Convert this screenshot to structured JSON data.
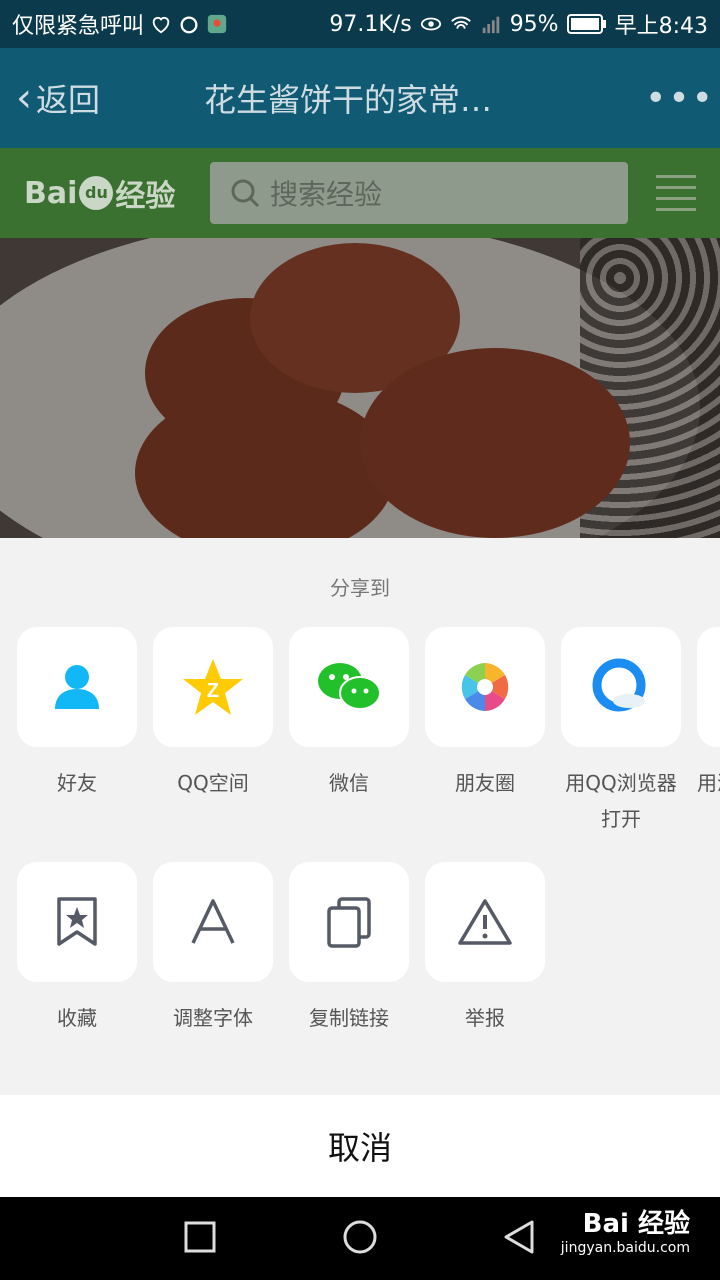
{
  "status_bar": {
    "carrier": "仅限紧急呼叫",
    "speed": "97.1K/s",
    "battery": "95%",
    "time": "早上8:43"
  },
  "app_bar": {
    "back_label": "返回",
    "title": "花生酱饼干的家常…",
    "more_icon": "more-dots-icon"
  },
  "baidu_header": {
    "logo_text_left": "Bai",
    "logo_text_paw": "du",
    "logo_text_right": "经验",
    "search_placeholder": "搜索经验"
  },
  "share_sheet": {
    "title": "分享到",
    "row1": [
      {
        "label": "好友",
        "icon": "qq-friend-icon"
      },
      {
        "label": "QQ空间",
        "icon": "qzone-star-icon"
      },
      {
        "label": "微信",
        "icon": "wechat-icon"
      },
      {
        "label": "朋友圈",
        "icon": "moments-aperture-icon"
      },
      {
        "label": "用QQ浏览器\n打开",
        "icon": "qq-browser-icon"
      },
      {
        "label": "用浏",
        "icon": "browser-icon"
      }
    ],
    "row2": [
      {
        "label": "收藏",
        "icon": "bookmark-star-icon"
      },
      {
        "label": "调整字体",
        "icon": "font-a-icon"
      },
      {
        "label": "复制链接",
        "icon": "copy-icon"
      },
      {
        "label": "举报",
        "icon": "warning-icon"
      }
    ],
    "cancel_label": "取消"
  },
  "watermark": {
    "logo": "Bai 经验",
    "url": "jingyan.baidu.com"
  }
}
